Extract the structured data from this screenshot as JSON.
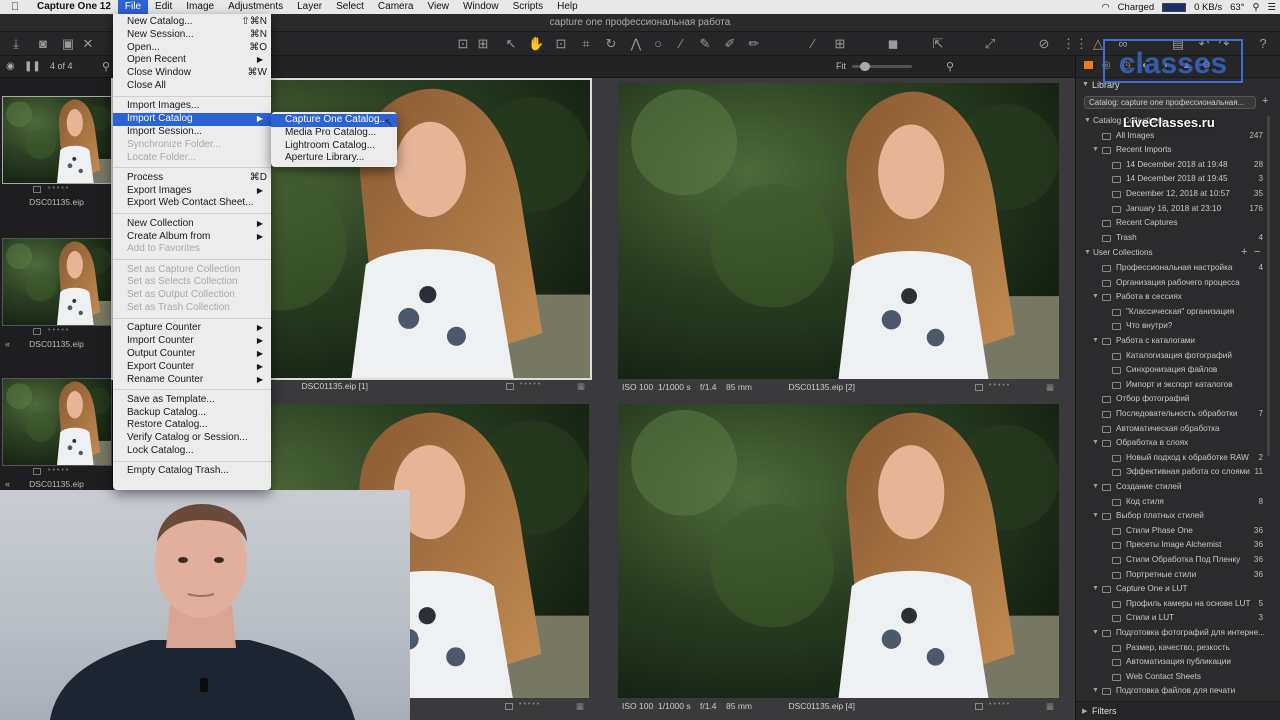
{
  "menubar": {
    "app": "Capture One 12",
    "items": [
      "File",
      "Edit",
      "Image",
      "Adjustments",
      "Layer",
      "Select",
      "Camera",
      "View",
      "Window",
      "Scripts",
      "Help"
    ],
    "active": "File",
    "status": {
      "battery": "Charged",
      "net": "0 KB/s",
      "temp": "63°"
    }
  },
  "window": {
    "title": "capture one профессиональная работа"
  },
  "viewer": {
    "count": "4 of 4",
    "fit_label": "Fit"
  },
  "filmstrip": {
    "thumbs": [
      {
        "label": "DSC01135.eip"
      },
      {
        "label": "DSC01135.eip"
      },
      {
        "label": "DSC01135.eip"
      }
    ]
  },
  "photos": [
    {
      "meta_left": "mm",
      "name": "DSC01135.eip [1]"
    },
    {
      "iso": "ISO 100",
      "shutter": "1/1000 s",
      "aperture": "f/1.4",
      "focal": "85 mm",
      "name": "DSC01135.eip [2]"
    },
    {
      "name": ""
    },
    {
      "iso": "ISO 100",
      "shutter": "1/1000 s",
      "aperture": "f/1.4",
      "focal": "85 mm",
      "name": "DSC01135.eip [4]"
    }
  ],
  "file_menu": {
    "items": [
      {
        "label": "New Catalog...",
        "shortcut": "⇧⌘N"
      },
      {
        "label": "New Session...",
        "shortcut": "⌘N"
      },
      {
        "label": "Open...",
        "shortcut": "⌘O"
      },
      {
        "label": "Open Recent",
        "submenu": true
      },
      {
        "label": "Close Window",
        "shortcut": "⌘W"
      },
      {
        "label": "Close All"
      },
      {
        "sep": true
      },
      {
        "label": "Import Images..."
      },
      {
        "label": "Import Catalog",
        "submenu": true,
        "highlight": true
      },
      {
        "label": "Import Session..."
      },
      {
        "label": "Synchronize Folder...",
        "disabled": true
      },
      {
        "label": "Locate Folder...",
        "disabled": true
      },
      {
        "sep": true
      },
      {
        "label": "Process",
        "shortcut": "⌘D"
      },
      {
        "label": "Export Images",
        "submenu": true
      },
      {
        "label": "Export Web Contact Sheet..."
      },
      {
        "sep": true
      },
      {
        "label": "New Collection",
        "submenu": true
      },
      {
        "label": "Create Album from",
        "submenu": true
      },
      {
        "label": "Add to Favorites",
        "disabled": true
      },
      {
        "sep": true
      },
      {
        "label": "Set as Capture Collection",
        "disabled": true
      },
      {
        "label": "Set as Selects Collection",
        "disabled": true
      },
      {
        "label": "Set as Output Collection",
        "disabled": true
      },
      {
        "label": "Set as Trash Collection",
        "disabled": true
      },
      {
        "sep": true
      },
      {
        "label": "Capture Counter",
        "submenu": true
      },
      {
        "label": "Import Counter",
        "submenu": true
      },
      {
        "label": "Output Counter",
        "submenu": true
      },
      {
        "label": "Export Counter",
        "submenu": true
      },
      {
        "label": "Rename Counter",
        "submenu": true
      },
      {
        "sep": true
      },
      {
        "label": "Save as Template..."
      },
      {
        "label": "Backup Catalog..."
      },
      {
        "label": "Restore Catalog..."
      },
      {
        "label": "Verify Catalog or Session..."
      },
      {
        "label": "Lock Catalog..."
      },
      {
        "sep": true
      },
      {
        "label": "Empty Catalog Trash..."
      }
    ]
  },
  "import_submenu": {
    "items": [
      {
        "label": "Capture One Catalog...",
        "highlight": true
      },
      {
        "label": "Media Pro Catalog..."
      },
      {
        "label": "Lightroom Catalog..."
      },
      {
        "label": "Aperture Library..."
      }
    ]
  },
  "library": {
    "header": "Library",
    "catalog_select": "Catalog: capture one профессиональная...",
    "section_catalog": "Catalog Collections",
    "section_user": "User Collections",
    "filters": "Filters",
    "rows": [
      {
        "label": "All Images",
        "count": "247",
        "indent": 1,
        "twisty": ""
      },
      {
        "label": "Recent Imports",
        "count": "",
        "indent": 1,
        "twisty": "▼"
      },
      {
        "label": "14 December 2018 at 19:48",
        "count": "28",
        "indent": 2,
        "twisty": ""
      },
      {
        "label": "14 December 2018 at 19:45",
        "count": "3",
        "indent": 2,
        "twisty": ""
      },
      {
        "label": "December 12, 2018 at 10:57",
        "count": "35",
        "indent": 2,
        "twisty": ""
      },
      {
        "label": "January 16, 2018 at 23:10",
        "count": "176",
        "indent": 2,
        "twisty": ""
      },
      {
        "label": "Recent Captures",
        "count": "",
        "indent": 1,
        "twisty": ""
      },
      {
        "label": "Trash",
        "count": "4",
        "indent": 1,
        "twisty": ""
      }
    ],
    "user_rows": [
      {
        "label": "Профессиональная настройка",
        "count": "4",
        "indent": 1,
        "twisty": ""
      },
      {
        "label": "Организация рабочего процесса",
        "count": "",
        "indent": 1,
        "twisty": ""
      },
      {
        "label": "Работа в сессиях",
        "count": "",
        "indent": 1,
        "twisty": "▼"
      },
      {
        "label": "\"Классическая\" организация",
        "count": "",
        "indent": 2,
        "twisty": ""
      },
      {
        "label": "Что внутри?",
        "count": "",
        "indent": 2,
        "twisty": ""
      },
      {
        "label": "Работа с каталогами",
        "count": "",
        "indent": 1,
        "twisty": "▼"
      },
      {
        "label": "Каталогизация фотографий",
        "count": "",
        "indent": 2,
        "twisty": ""
      },
      {
        "label": "Синхронизация файлов",
        "count": "",
        "indent": 2,
        "twisty": ""
      },
      {
        "label": "Импорт и экспорт каталогов",
        "count": "",
        "indent": 2,
        "twisty": ""
      },
      {
        "label": "Отбор фотографий",
        "count": "",
        "indent": 1,
        "twisty": ""
      },
      {
        "label": "Последовательность обработки",
        "count": "7",
        "indent": 1,
        "twisty": ""
      },
      {
        "label": "Автоматическая обработка",
        "count": "",
        "indent": 1,
        "twisty": ""
      },
      {
        "label": "Обработка в слоях",
        "count": "",
        "indent": 1,
        "twisty": "▼"
      },
      {
        "label": "Новый подход к обработке RAW",
        "count": "2",
        "indent": 2,
        "twisty": ""
      },
      {
        "label": "Эффективная работа со слоями",
        "count": "11",
        "indent": 2,
        "twisty": ""
      },
      {
        "label": "Создание стилей",
        "count": "",
        "indent": 1,
        "twisty": "▼"
      },
      {
        "label": "Код стиля",
        "count": "8",
        "indent": 2,
        "twisty": ""
      },
      {
        "label": "Выбор платных стилей",
        "count": "",
        "indent": 1,
        "twisty": "▼"
      },
      {
        "label": "Стили Phase One",
        "count": "36",
        "indent": 2,
        "twisty": ""
      },
      {
        "label": "Пресеты Image Alchemist",
        "count": "36",
        "indent": 2,
        "twisty": ""
      },
      {
        "label": "Стили Обработка Под Пленку",
        "count": "36",
        "indent": 2,
        "twisty": ""
      },
      {
        "label": "Портретные стили",
        "count": "36",
        "indent": 2,
        "twisty": ""
      },
      {
        "label": "Capture One и LUT",
        "count": "",
        "indent": 1,
        "twisty": "▼"
      },
      {
        "label": "Профиль камеры на основе LUT",
        "count": "5",
        "indent": 2,
        "twisty": ""
      },
      {
        "label": "Стили и LUT",
        "count": "3",
        "indent": 2,
        "twisty": ""
      },
      {
        "label": "Подготовка фотографий для интерне...",
        "count": "",
        "indent": 1,
        "twisty": "▼"
      },
      {
        "label": "Размер, качество, резкость",
        "count": "",
        "indent": 2,
        "twisty": ""
      },
      {
        "label": "Автоматизация публикации",
        "count": "",
        "indent": 2,
        "twisty": ""
      },
      {
        "label": "Web Contact Sheets",
        "count": "",
        "indent": 2,
        "twisty": ""
      },
      {
        "label": "Подготовка файлов для печати",
        "count": "",
        "indent": 1,
        "twisty": "▼"
      }
    ]
  },
  "watermark": {
    "brand": "classes",
    "url": "LiveClasses.ru"
  },
  "colors": {
    "accent": "#2d62d6",
    "logo": "#3a6fd8",
    "orange": "#f07a1a"
  }
}
